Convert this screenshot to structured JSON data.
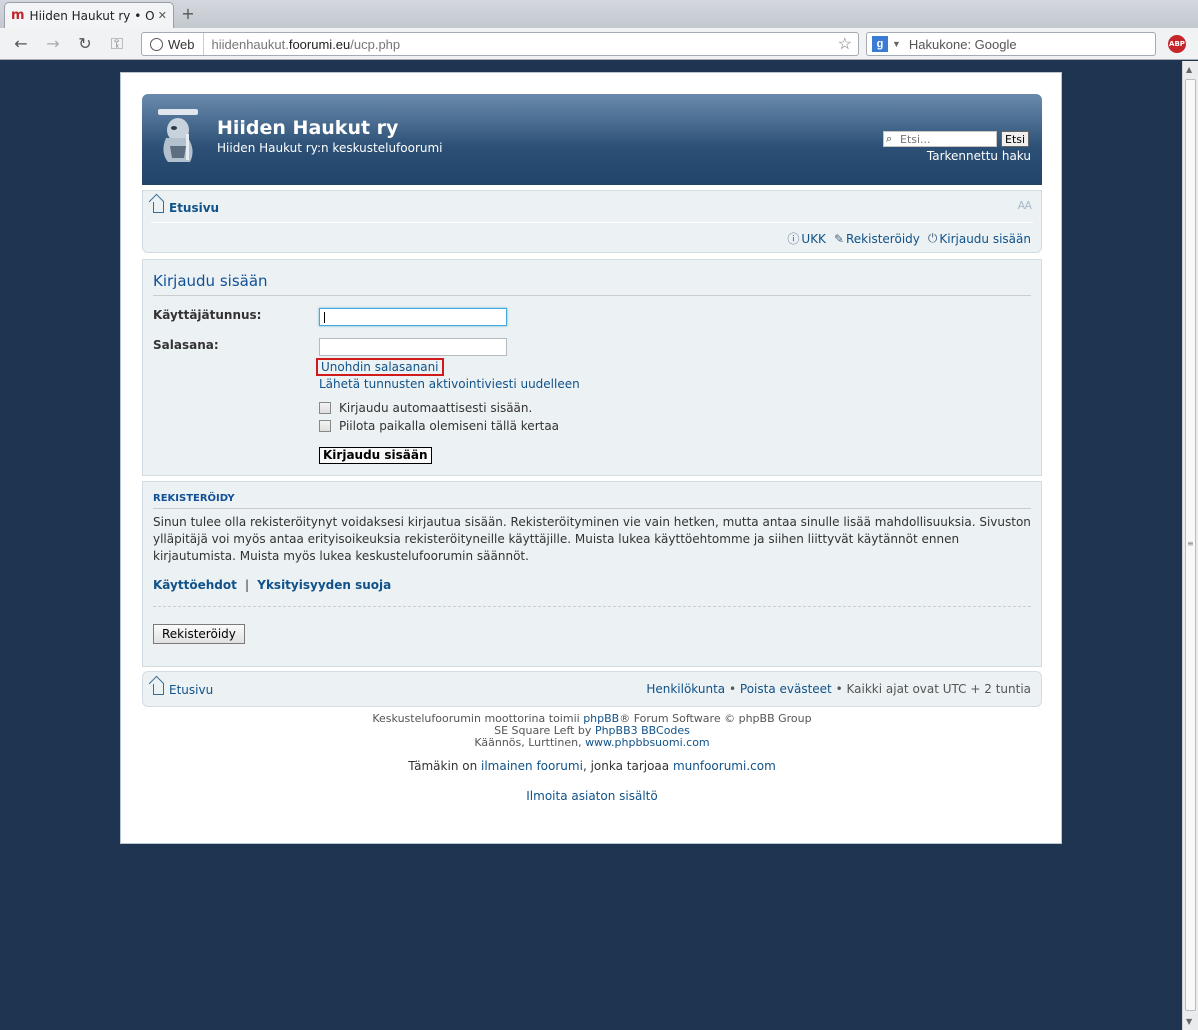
{
  "browser": {
    "tab_title": "Hiiden Haukut ry • Om…",
    "tab_favicon": "m",
    "omnibox_chip": "Web",
    "url_prefix": "hiidenhaukut.",
    "url_domain": "foorumi.eu",
    "url_path": "/ucp.php",
    "search_engine_label": "Hakukone: Google",
    "search_engine_icon": "g",
    "extension_label": "ABP"
  },
  "header": {
    "site_title": "Hiiden Haukut ry",
    "site_desc": "Hiiden Haukut ry:n keskustelufoorumi",
    "search_placeholder": "Etsi...",
    "search_button": "Etsi",
    "advanced_search": "Tarkennettu haku"
  },
  "navbar": {
    "home": "Etusivu",
    "font_size_toggle": "AA",
    "links": [
      {
        "label": "UKK",
        "icon": "question-icon"
      },
      {
        "label": "Rekisteröidy",
        "icon": "register-icon"
      },
      {
        "label": "Kirjaudu sisään",
        "icon": "power-icon"
      }
    ]
  },
  "login": {
    "title": "Kirjaudu sisään",
    "username_label": "Käyttäjätunnus:",
    "password_label": "Salasana:",
    "forgot_link": "Unohdin salasanani",
    "resend_link": "Lähetä tunnusten aktivointiviesti uudelleen",
    "autologin_label": "Kirjaudu automaattisesti sisään.",
    "hide_online_label": "Piilota paikalla olemiseni tällä kertaa",
    "submit_button": "Kirjaudu sisään"
  },
  "register": {
    "title": "REKISTERÖIDY",
    "text": "Sinun tulee olla rekisteröitynyt voidaksesi kirjautua sisään. Rekisteröityminen vie vain hetken, mutta antaa sinulle lisää mahdollisuuksia. Sivuston ylläpitäjä voi myös antaa erityisoikeuksia rekisteröityneille käyttäjille. Muista lukea käyttöehtomme ja siihen liittyvät käytännöt ennen kirjautumista. Muista myös lukea keskustelufoorumin säännöt.",
    "terms_link": "Käyttöehdot",
    "separator": "|",
    "privacy_link": "Yksityisyyden suoja",
    "button": "Rekisteröidy"
  },
  "footer": {
    "home": "Etusivu",
    "members": "Henkilökunta",
    "bullet": "•",
    "delete_cookies": "Poista evästeet",
    "timezone": "Kaikki ajat ovat UTC + 2 tuntia",
    "powered_pre": "Keskustelufoorumin moottorina toimii ",
    "powered_link": "phpBB",
    "powered_post": "® Forum Software © phpBB Group",
    "style_pre": "SE Square Left by ",
    "style_link": "PhpBB3 BBCodes",
    "translation_pre": "Käännös, Lurttinen, ",
    "translation_link": "www.phpbbsuomi.com",
    "promo_pre": "Tämäkin on ",
    "promo_link1": "ilmainen foorumi",
    "promo_mid": ", jonka tarjoaa ",
    "promo_link2": "munfoorumi.com",
    "report": "Ilmoita asiaton sisältö"
  }
}
